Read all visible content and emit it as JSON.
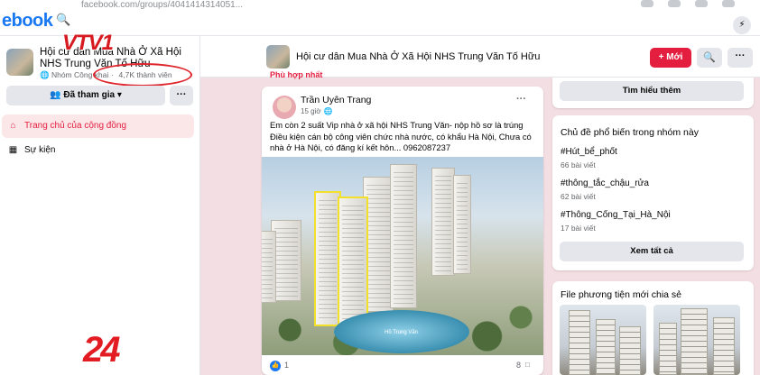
{
  "topbar": {
    "logo": "ebook",
    "url": "facebook.com/groups/4041414314051...",
    "messenger_icon": "messenger-icon"
  },
  "group": {
    "name": "Hội cư dân Mua Nhà Ở Xã Hội NHS Trung Văn Tố Hữu",
    "privacy": "Nhóm Công khai",
    "members": "4,7K thành viên",
    "joined_label": "Đã tham gia",
    "more_label": "···"
  },
  "nav": {
    "home": "Trang chủ của cộng đồng",
    "events": "Sự kiện"
  },
  "subheader": {
    "title": "Hội cư dân Mua Nhà Ở Xã Hội NHS Trung Văn Tố Hữu",
    "new_label": "+ Mới",
    "more_label": "···"
  },
  "featured_label": "Phù hợp nhất",
  "post": {
    "author": "Trần Uyên Trang",
    "time": "15 giờ",
    "text": "Em còn 2 suất Vip nhà ở xã hội NHS Trung Văn- nộp hồ sơ là trúng\nĐiều kiện cán bộ công viên chức nhà nước, có khẩu Hà Nội, Chưa có nhà ở Hà Nội, có đăng kí kết hôn... 0962087237",
    "image_caption": "Hồ Trung Văn",
    "likes": "1",
    "comments": "8"
  },
  "right": {
    "learn_more": "Tìm hiểu thêm",
    "topics_title": "Chủ đề phổ biến trong nhóm này",
    "topics": [
      {
        "tag": "#Hút_bể_phốt",
        "count": "66 bài viết"
      },
      {
        "tag": "#thông_tắc_chậu_rửa",
        "count": "62 bài viết"
      },
      {
        "tag": "#Thông_Cống_Tại_Hà_Nội",
        "count": "17 bài viết"
      }
    ],
    "see_all": "Xem tất cả",
    "media_title": "File phương tiện mới chia sẻ"
  },
  "overlay": {
    "channel_logo": "VTV1",
    "program_logo": "24"
  },
  "colors": {
    "facebook_blue": "#1877f2",
    "accent_red": "#e41e3f",
    "highlight_oval": "#e0242b",
    "vtv_red": "#d71920"
  }
}
